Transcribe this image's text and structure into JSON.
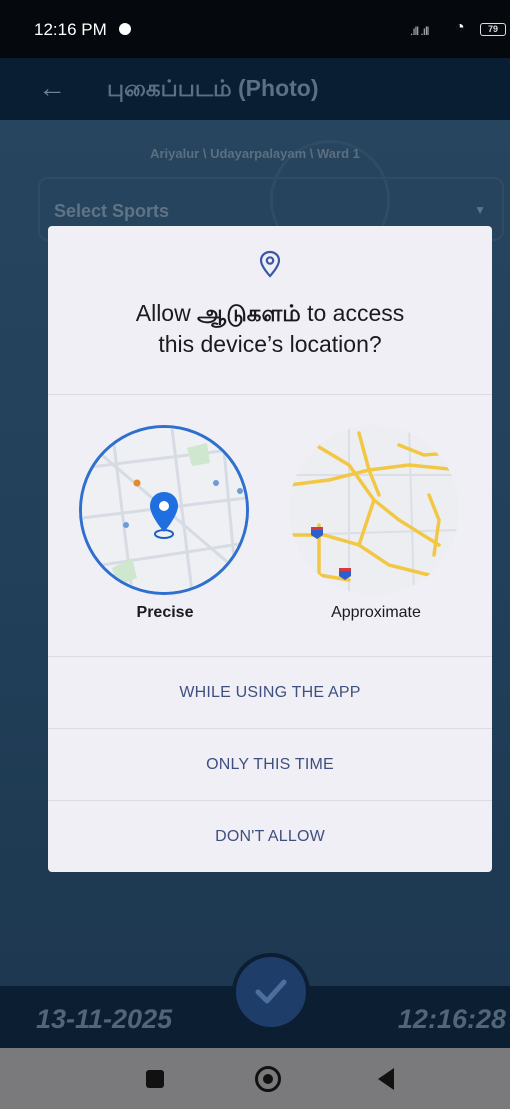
{
  "status_bar": {
    "time": "12:16 PM",
    "signal": ".ıll .ıll",
    "battery": "79"
  },
  "app_bar": {
    "title": "புகைப்படம் (Photo)"
  },
  "background": {
    "location_path": "Ariyalur \\ Udayarpalayam \\ Ward 1",
    "sports_select": "Select Sports",
    "date": "13-11-2025",
    "time": "12:16:28"
  },
  "dialog": {
    "title_prefix": "Allow",
    "app_name": "ஆடுகளம்",
    "title_suffix": "to access",
    "title_line2": "this device’s location?",
    "precise_label": "Precise",
    "approximate_label": "Approximate",
    "buttons": {
      "while_using": "WHILE USING THE APP",
      "only_this_time": "ONLY THIS TIME",
      "dont_allow": "DON'T ALLOW"
    }
  },
  "colors": {
    "accent": "#2f6fce",
    "button_text": "#3f4f80",
    "dialog_bg": "#f0eff5"
  },
  "icons": [
    "back-arrow-icon",
    "location-pin-icon",
    "checkmark-icon",
    "recent-apps-icon",
    "home-icon",
    "back-icon"
  ]
}
